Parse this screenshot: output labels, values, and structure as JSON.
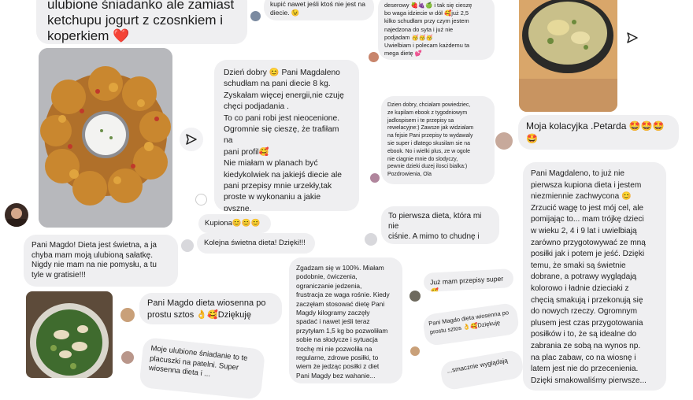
{
  "c1": {
    "top_text": "ulubione śniadanko ale zamiast\nketchupu jogurt z czosnkiem i\nkoperkiem ❤️",
    "magdo_text": "Pani Magdo! Dieta jest świetna, a ja\nchyba mam moją ulubioną sałatkę.\nNigdy nie mam na nie pomysłu, a tu\ntyle w gratisie!!!"
  },
  "c2": {
    "top_text": "kupić nawet jeśli ktoś nie jest na\ndiecie. 😉",
    "long_text": "Dzień dobry 😊 Pani Magdaleno\nschudłam na pani diecie 8 kg.\nZyskałam więcej energii,nie czuję\nchęci podjadania .\nTo co pani robi jest nieocenione.\nOgromnie się cieszę, że trafiłam na\npani profil🥰\nNie miałam w planach być\nkiedykolwiek na jakiejś diecie ale\npani przepisy mnie urzekły,tak\nproste w wykonaniu a jakie pyszne.\nTo jest teraz mój styl życia 😊\nBardzo ale to bardzo dziękuję 😊",
    "kupiona_text": "Kupiona😊😊😊",
    "kolejna_text": "Kolejna świetna dieta! Dzięki!!!",
    "wiosenna_text": "Pani Magdo dieta wiosenna po\nprostu sztos 👌🥰Dziękuję",
    "sniadanie_text": "Moje ulubione śniadanie to te\nplacuszki na patelni. Super\nwiosenna dieta i ..."
  },
  "c3": {
    "top_text": "deserowy 🍓🍇🍏 i tak się cieszę\nbo waga idziecie w dół 🥰już  2,5\nkilko schudłam przy czym jestem\nnajedzona do syta i już nie\npodjadam 🥳🥳🥳\nUwielbiam i polecam każdemu ta\nmega dietę 💕",
    "ola_text": "Dzien dobry, chcialam powiedziec,\nze kupilam ebook z tygodniowym\njadlospisem i te przepisy sa\nrewelacyjne:) Zawsze jak widzialam\nna fejsie Pani przepisy to wydawaly\nsie super i dlatego skusilam sie na\nebook.  No i wielki plus, ze w ogole\nnie ciagnie mnie do slodyczy,\npewnie dzieki duzej ilosci bialka:)\nPozdrowienia, Ola",
    "pierwsza_text": "To pierwsza dieta, która mi nie\nciśnie. A mimo to chudnę i mam\nenergię.",
    "zgadzam_text": "Zgadzam się w 100%. Miałam\npodobnie, ćwiczenia,\nograniczanie jedzenia,\nfrustracja ze waga rośnie. Kiedy\nzaczęłam stosować dietę Pani\nMagdy kilogramy zaczęły\nspadać i nawet jeśli teraz\nprzytyłam 1,5 kg bo pozwoliłam\nsobie na słodycze i sytuacja\ntrochę mi nie pozwoliła na\nregularne, zdrowe posiłki, to\nwiem że jedząc posiłki z diet\nPani Magdy bez wahanie...",
    "super_text": "Już mam przepisy super🥰",
    "tilted_text": "Pani Magdo dieta wiosenna po\nprostu sztos 👌🥰Dziękuję",
    "wygladaja_text": "...smacznie wyglądają"
  },
  "c4": {
    "kolacja_text": "Moja kolacyjka .Petarda 🤩🤩🤩\n🤩",
    "long_text": "Pani Magdaleno, to już nie\npierwsza kupiona dieta i jestem\nniezmiennie zachwycona 😊\nZrzucić wagę to jest mój cel, ale\npomijając to... mam trójkę dzieci\nw wieku 2, 4 i 9 lat i uwielbiają\nzarówno przygotowywać ze mną\nposiłki jak i potem je jeść. Dzięki\ntemu, że smaki są świetnie\ndobrane, a potrawy wyglądają\nkolorowo i ładnie dzieciaki z\nchęcią smakują i przekonują się\ndo nowych rzeczy. Ogromnym\nplusem jest czas przygotowania\nposiłków i to, że są idealne do\nzabrania ze sobą na wynos np.\nna plac zabaw, co na wiosnę i\nlatem jest nie do przecenienia.\nDzięki smakowaliśmy pierwsze..."
  },
  "colors": {
    "bubble": "#efeff1",
    "page": "#ffffff",
    "text": "#1c1c1c"
  }
}
